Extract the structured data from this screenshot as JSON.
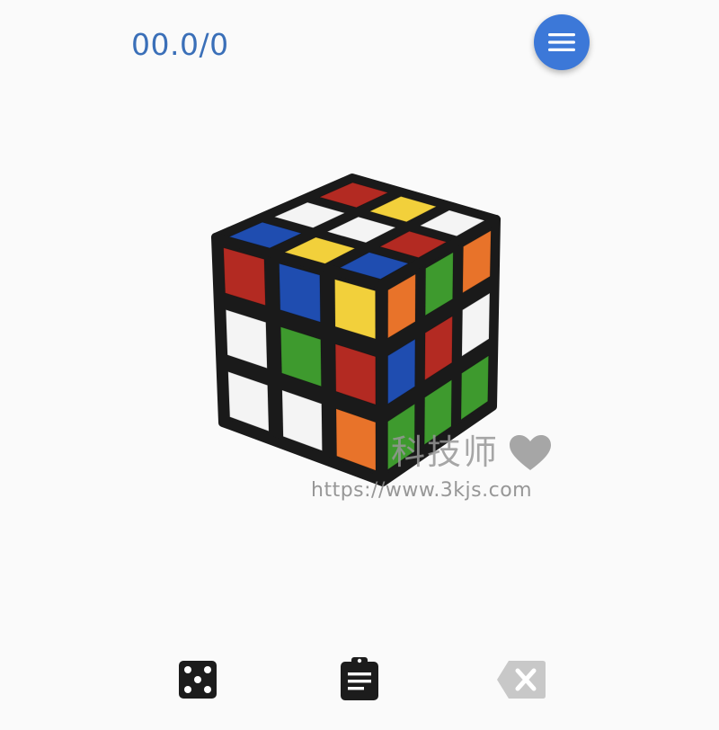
{
  "timer": {
    "display": "00.0/0"
  },
  "menu_button": {
    "icon": "hamburger-menu-icon"
  },
  "colors": {
    "accent": "#3c78d8",
    "timer_text": "#3a6fb8",
    "sticker_red": "#b32a22",
    "sticker_white": "#f4f4f4",
    "sticker_yellow": "#f2d03b",
    "sticker_blue": "#1f4db0",
    "sticker_green": "#3e9a2e",
    "sticker_orange": "#e8732a",
    "cube_body": "#1a1a1a",
    "icon_dark": "#1c1c1c",
    "icon_disabled": "#c8c8c8"
  },
  "cube": {
    "top": [
      [
        "red",
        "yellow",
        "white"
      ],
      [
        "white",
        "white",
        "red"
      ],
      [
        "blue",
        "yellow",
        "blue"
      ]
    ],
    "left": [
      [
        "red",
        "blue",
        "yellow"
      ],
      [
        "white",
        "green",
        "red"
      ],
      [
        "white",
        "white",
        "orange"
      ]
    ],
    "right": [
      [
        "orange",
        "green",
        "orange"
      ],
      [
        "blue",
        "red",
        "white"
      ],
      [
        "green",
        "green",
        "green"
      ]
    ]
  },
  "watermark": {
    "title": "科技师",
    "url": "https://www.3kjs.com",
    "icon": "heart-icon"
  },
  "toolbar": {
    "scramble_icon": "dice-icon",
    "solution_icon": "clipboard-icon",
    "clear_icon": "backspace-icon"
  }
}
